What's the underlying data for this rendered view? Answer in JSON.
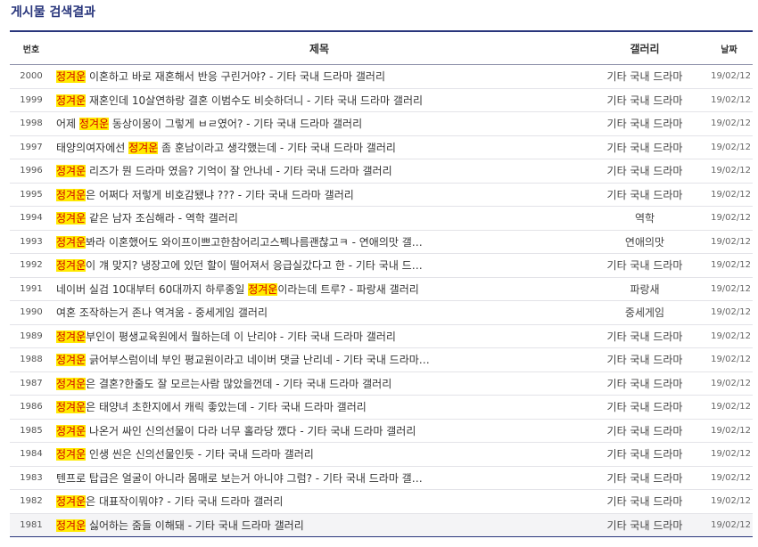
{
  "page_title": "게시물 검색결과",
  "columns": {
    "num": "번호",
    "title": "제목",
    "gallery": "갤러리",
    "date": "날짜"
  },
  "highlight_color": "#ffea00",
  "highlight_text_color": "#d20000",
  "rows": [
    {
      "num": "2000",
      "pre": "",
      "hl": "정겨운",
      "post": " 이혼하고 바로 재혼해서 반응 구린거야? - 기타 국내 드라마 갤러리",
      "gallery": "기타 국내 드라마",
      "date": "19/02/12"
    },
    {
      "num": "1999",
      "pre": "",
      "hl": "정겨운",
      "post": " 재혼인데 10살연하랑 결혼 이범수도 비슷하더니 - 기타 국내 드라마 갤러리",
      "gallery": "기타 국내 드라마",
      "date": "19/02/12"
    },
    {
      "num": "1998",
      "pre": "어제 ",
      "hl": "정겨운",
      "post": " 동상이몽이 그렇게 ㅂㄹ였어? - 기타 국내 드라마 갤러리",
      "gallery": "기타 국내 드라마",
      "date": "19/02/12"
    },
    {
      "num": "1997",
      "pre": "태양의여자에선 ",
      "hl": "정겨운",
      "post": " 좀 훈남이라고 생각했는데 - 기타 국내 드라마 갤러리",
      "gallery": "기타 국내 드라마",
      "date": "19/02/12"
    },
    {
      "num": "1996",
      "pre": "",
      "hl": "정겨운",
      "post": " 리즈가 뭔 드라마 였음? 기억이 잘 안나네 - 기타 국내 드라마 갤러리",
      "gallery": "기타 국내 드라마",
      "date": "19/02/12"
    },
    {
      "num": "1995",
      "pre": "",
      "hl": "정겨운",
      "post": "은 어쩌다 저렇게 비호감됐냐 ??? - 기타 국내 드라마 갤러리",
      "gallery": "기타 국내 드라마",
      "date": "19/02/12"
    },
    {
      "num": "1994",
      "pre": "",
      "hl": "정겨운",
      "post": " 같은 남자 조심해라 - 역학 갤러리",
      "gallery": "역학",
      "date": "19/02/12"
    },
    {
      "num": "1993",
      "pre": "",
      "hl": "정겨운",
      "post": "봐라 이혼했어도 와이프이쁘고한참어리고스펙나름괜찮고ㅋ - 연애의맛 갤…",
      "gallery": "연애의맛",
      "date": "19/02/12"
    },
    {
      "num": "1992",
      "pre": "",
      "hl": "정겨운",
      "post": "이 걔 맞지? 냉장고에 있던 할이 떨어져서 응급실갔다고 한 - 기타 국내 드…",
      "gallery": "기타 국내 드라마",
      "date": "19/02/12"
    },
    {
      "num": "1991",
      "pre": "네이버 실검 10대부터 60대까지 하루종일 ",
      "hl": "정겨운",
      "post": "이라는데 트루? - 파랑새 갤러리",
      "gallery": "파랑새",
      "date": "19/02/12"
    },
    {
      "num": "1990",
      "pre": "여혼 조작하는거 존나 역겨움 - 중세게임 갤러리",
      "hl": "",
      "post": "",
      "gallery": "중세게임",
      "date": "19/02/12"
    },
    {
      "num": "1989",
      "pre": "",
      "hl": "정겨운",
      "post": "부인이 평생교육원에서 뭘하는데 이 난리야 - 기타 국내 드라마 갤러리",
      "gallery": "기타 국내 드라마",
      "date": "19/02/12"
    },
    {
      "num": "1988",
      "pre": "",
      "hl": "정겨운",
      "post": " 긁어부스럼이네 부인 평교원이라고 네이버 댓글 난리네 - 기타 국내 드라마…",
      "gallery": "기타 국내 드라마",
      "date": "19/02/12"
    },
    {
      "num": "1987",
      "pre": "",
      "hl": "정겨운",
      "post": "은 결혼?한줄도 잘 모르는사람 많았을껀데 - 기타 국내 드라마 갤러리",
      "gallery": "기타 국내 드라마",
      "date": "19/02/12"
    },
    {
      "num": "1986",
      "pre": "",
      "hl": "정겨운",
      "post": "은 태양녀 초한지에서 캐릭 좋았는데 - 기타 국내 드라마 갤러리",
      "gallery": "기타 국내 드라마",
      "date": "19/02/12"
    },
    {
      "num": "1985",
      "pre": "",
      "hl": "정겨운",
      "post": " 나온거 싸인 신의선물이 다라 너무 홀라당 깼다 - 기타 국내 드라마 갤러리",
      "gallery": "기타 국내 드라마",
      "date": "19/02/12"
    },
    {
      "num": "1984",
      "pre": "",
      "hl": "정겨운",
      "post": " 인생 씬은 신의선물인듯 - 기타 국내 드라마 갤러리",
      "gallery": "기타 국내 드라마",
      "date": "19/02/12"
    },
    {
      "num": "1983",
      "pre": "텐프로 탑급은 얼굴이 아니라 몸매로 보는거 아니야 그럼? - 기타 국내 드라마 갤…",
      "hl": "",
      "post": "",
      "gallery": "기타 국내 드라마",
      "date": "19/02/12"
    },
    {
      "num": "1982",
      "pre": "",
      "hl": "정겨운",
      "post": "은 대표작이뭐야? - 기타 국내 드라마 갤러리",
      "gallery": "기타 국내 드라마",
      "date": "19/02/12"
    },
    {
      "num": "1981",
      "pre": "",
      "hl": "정겨운",
      "post": " 싫어하는 줌들 이해돼 - 기타 국내 드라마 갤러리",
      "gallery": "기타 국내 드라마",
      "date": "19/02/12"
    }
  ]
}
